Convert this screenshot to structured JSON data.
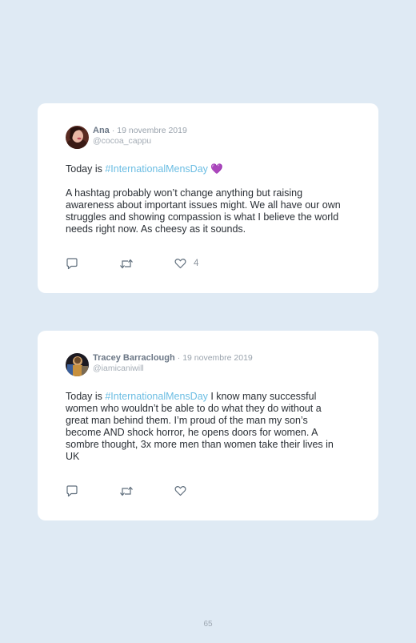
{
  "posts": [
    {
      "name": "Ana",
      "date": "· 19 novembre 2019",
      "handle": "@cocoa_cappu",
      "line1_prefix": "Today is ",
      "line1_hashtag": "#InternationalMensDay",
      "line1_suffix": " 💜",
      "paragraph2": "A hashtag probably won’t change anything but raising awareness about important issues might. We all have our own struggles and showing compassion is what I believe the world needs right now. As cheesy as it sounds.",
      "like_count": "4",
      "icons": [
        "reply-icon",
        "retweet-icon",
        "heart-icon"
      ]
    },
    {
      "name": "Tracey Barraclough",
      "date": "· 19 novembre 2019",
      "handle": "@iamicaniwill",
      "line1_prefix": "Today is ",
      "line1_hashtag": "#InternationalMensDay",
      "line1_suffix": " I know many successful women who wouldn’t be able to do what they do without a great man behind them. I’m proud of the man my son’s become AND shock horror, he opens doors for women. A sombre thought, 3x more men than women take their lives in UK",
      "like_count": "",
      "icons": [
        "reply-icon",
        "retweet-icon",
        "heart-icon"
      ]
    }
  ],
  "footer": {
    "page_number": "65"
  },
  "colors": {
    "background": "#dfeaf4",
    "hashtag": "#6bbde3",
    "name": "#6b7786"
  }
}
